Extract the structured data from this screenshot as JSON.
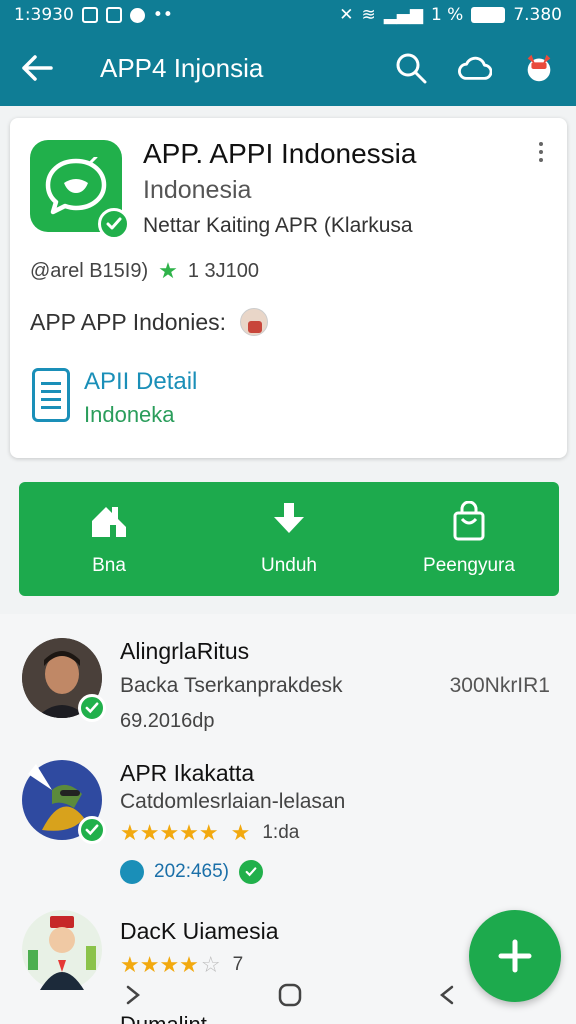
{
  "status_bar": {
    "time": "1:3930",
    "battery_text": "1 %",
    "clock_right": "7.380"
  },
  "app_bar": {
    "title": "APP4 Injonsia"
  },
  "app_card": {
    "name": "APP. APPI Indonessia",
    "subtitle": "Indonesia",
    "developer": "Nettar Kaiting APR (Klarkusa",
    "meta": "@arel B15I9)",
    "rating": "1 3J100",
    "tagline": "APP APP Indonies:",
    "detail_title": "APII Detail",
    "detail_subtitle": "Indoneka"
  },
  "actions": [
    {
      "label": "Bna",
      "icon": "home-icon"
    },
    {
      "label": "Unduh",
      "icon": "download-icon"
    },
    {
      "label": "Peengyura",
      "icon": "shopping-bag-icon"
    }
  ],
  "list": [
    {
      "name": "AlingrlaRitus",
      "desc": "Backa Tserkanprakdesk",
      "sub": "69.2016dp",
      "right": "300NkrIR1",
      "verified": true
    },
    {
      "name": "APR Ikakatta",
      "desc": "Catdomlesrlaian-lelasan",
      "rating_count": "1:da",
      "stars": 5,
      "badge_text": "202:465)"
    },
    {
      "name": "DacK Uiamesia",
      "stars": 4,
      "rating_count": "7"
    }
  ],
  "footer": {
    "partial_text": "Dumalint"
  },
  "colors": {
    "primary": "#0f7d95",
    "accent_green": "#1daa4d",
    "star": "#f2a90f",
    "link_blue": "#1a8fb8"
  }
}
